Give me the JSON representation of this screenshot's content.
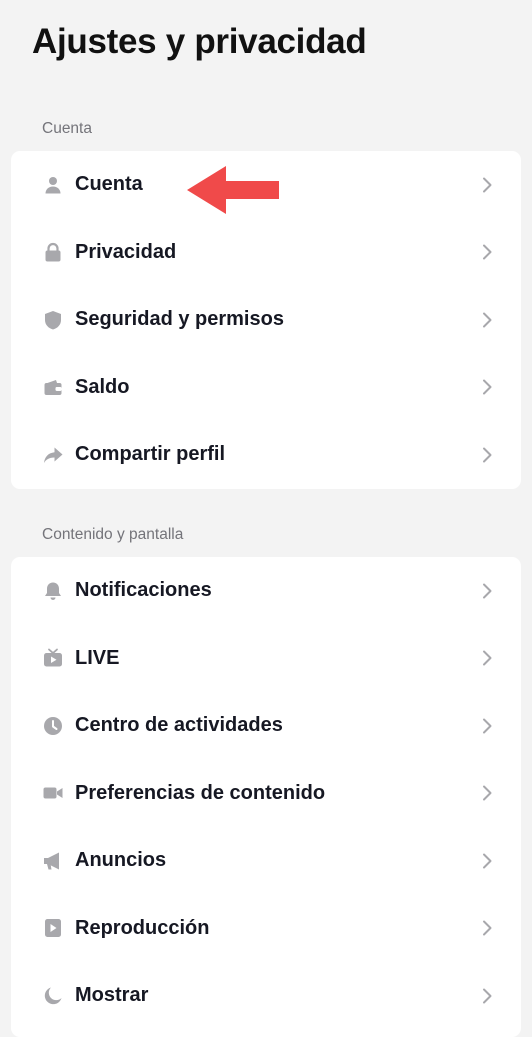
{
  "header": {
    "title": "Ajustes y privacidad"
  },
  "sections": [
    {
      "label": "Cuenta",
      "items": [
        {
          "label": "Cuenta",
          "icon": "person-icon"
        },
        {
          "label": "Privacidad",
          "icon": "lock-icon"
        },
        {
          "label": "Seguridad y permisos",
          "icon": "shield-icon"
        },
        {
          "label": "Saldo",
          "icon": "wallet-icon"
        },
        {
          "label": "Compartir perfil",
          "icon": "share-arrow-icon"
        }
      ]
    },
    {
      "label": "Contenido y pantalla",
      "items": [
        {
          "label": "Notificaciones",
          "icon": "bell-icon"
        },
        {
          "label": "LIVE",
          "icon": "tv-icon"
        },
        {
          "label": "Centro de actividades",
          "icon": "clock-icon"
        },
        {
          "label": "Preferencias de contenido",
          "icon": "video-camera-icon"
        },
        {
          "label": "Anuncios",
          "icon": "megaphone-icon"
        },
        {
          "label": "Reproducción",
          "icon": "play-icon"
        },
        {
          "label": "Mostrar",
          "icon": "moon-icon"
        }
      ]
    }
  ],
  "annotation": {
    "arrow_color": "#f04a4a",
    "icon": "red-arrow-pointer-icon"
  },
  "colors": {
    "background": "#f3f3f3",
    "card": "#ffffff",
    "icon": "#a8a8ac",
    "chevron": "#a8a8ac",
    "text": "#161823",
    "section_label": "#74747a"
  }
}
